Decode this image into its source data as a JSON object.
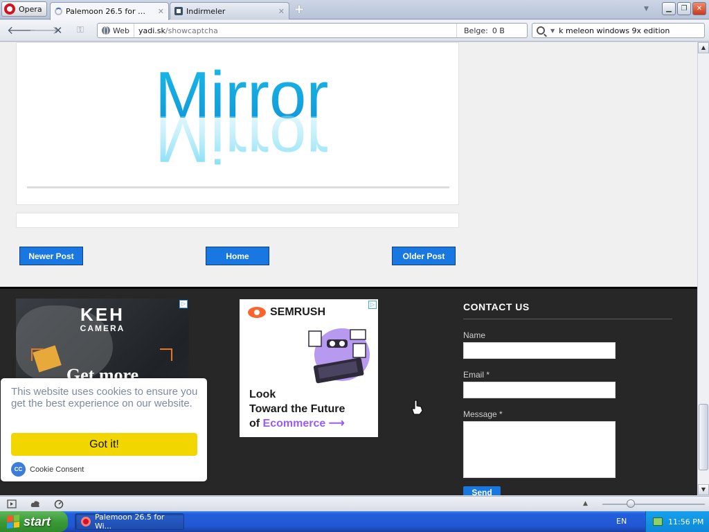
{
  "browser": {
    "menu_label": "Opera",
    "tabs": [
      {
        "title": "Palemoon 26.5 for Wind...",
        "active": true
      },
      {
        "title": "Indirmeler",
        "active": false
      }
    ],
    "address": {
      "scheme_label": "Web",
      "domain": "yadi.sk",
      "path": "/showcaptcha",
      "size_label": "Belge:",
      "size_value": "0 B"
    },
    "search": {
      "value": "k meleon windows 9x edition"
    }
  },
  "page": {
    "captcha_text": "Mirror",
    "pager": {
      "newer": "Newer Post",
      "home": "Home",
      "older": "Older Post"
    },
    "ad1": {
      "brand": "KEH",
      "sub": "CAMERA",
      "cta": "Get more"
    },
    "ad2": {
      "brand": "SEMRUSH",
      "line1": "Look",
      "line2": "Toward the Future",
      "line3_prefix": "of ",
      "line3_accent": "Ecommerce"
    },
    "contact": {
      "title": "CONTACT US",
      "name_label": "Name",
      "email_label": "Email *",
      "message_label": "Message *",
      "send_label": "Send"
    },
    "cookie": {
      "message": "This website uses cookies to ensure you get the best experience on our website.",
      "button": "Got it!",
      "brand": "Cookie Consent"
    }
  },
  "taskbar": {
    "start_label": "start",
    "task_label": "Palemoon 26.5 for Wi...",
    "lang": "EN",
    "clock": "11:56 PM"
  },
  "colors": {
    "accent_blue": "#1877e0",
    "footer_bg": "#272727",
    "cookie_button": "#f1d600",
    "captcha_cyan": "#19bde8"
  }
}
